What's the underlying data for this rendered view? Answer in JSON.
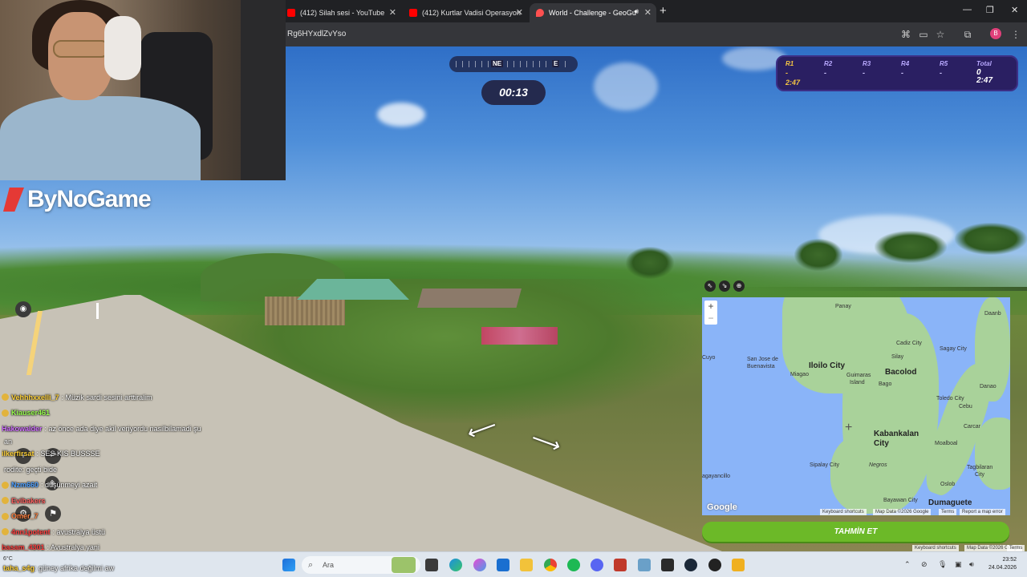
{
  "browser": {
    "tabs": [
      {
        "title": "(412) Silah sesi - YouTube",
        "color": "#ff0000"
      },
      {
        "title": "(412) Kurtlar Vadisi Operasyon",
        "color": "#ff0000"
      },
      {
        "title": "World - Challenge - GeoGu",
        "color": "#ff5050"
      }
    ],
    "url": "Rg6HYxdlZvYso"
  },
  "stream": {
    "logo_text": "ByNoGame"
  },
  "game": {
    "compass": {
      "ne": "NE",
      "e": "E"
    },
    "timer": "00:13",
    "rounds": [
      {
        "label": "R1",
        "value": "2:47"
      },
      {
        "label": "R2",
        "value": "-"
      },
      {
        "label": "R3",
        "value": "-"
      },
      {
        "label": "R4",
        "value": "-"
      },
      {
        "label": "R5",
        "value": "-"
      }
    ],
    "total": {
      "label": "Total",
      "score": "0",
      "time": "2:47"
    },
    "guess_button": "TAHMİN ET",
    "keyboard_shortcuts_bottom": "Keyboard shortcuts",
    "map_data_bottom": "Map Data ©2026 Google",
    "terms_bottom": "Terms"
  },
  "map": {
    "labels": {
      "panay": "Panay",
      "iloilo": "Iloilo City",
      "bacolod": "Bacolod",
      "sanjose": "San Jose de",
      "buenavista": "Buenavista",
      "miagao": "Miagao",
      "guimaras": "Guimaras",
      "island": "Island",
      "bago": "Bago",
      "silay": "Silay",
      "cadiz": "Cadiz City",
      "sagay": "Sagay City",
      "daanb": "Daanb",
      "toledo": "Toledo City",
      "cebu": "Cebu",
      "danao": "Danao",
      "kabankalan": "Kabankalan",
      "city": "City",
      "carcar": "Carcar",
      "moalboal": "Moalboal",
      "sipalay": "Sipalay City",
      "negros": "Negros",
      "tagbilaran": "Tagbilaran",
      "city2": "City",
      "oslob": "Oslob",
      "bayawan": "Bayawan City",
      "dumaguete": "Dumaguete",
      "cuyo": "Cuyo",
      "agayancillo": "agayancillo"
    },
    "google": "Google",
    "shortcuts": "Keyboard shortcuts",
    "mapdata": "Map Data ©2026 Google",
    "terms": "Terms",
    "report": "Report a map error"
  },
  "chat": [
    {
      "user": "Vehhhxxelli_7",
      "text": ": Müzik sardi sesini arttiralim",
      "color": "#ffd23a"
    },
    {
      "user": "Kiauser461",
      "text": "",
      "color": "#9aff50"
    },
    {
      "user": "Hakowalder",
      "text": ": az önce ada diye akil veriyordu nasilbilamadi şu",
      "color": "#d070ff"
    },
    {
      "user": "",
      "text": "an",
      "color": "#ffffff"
    },
    {
      "user": "ilkerfirsat",
      "text": ": SES KIS BUSSSE",
      "color": "#ffd23a"
    },
    {
      "user": "",
      "text": "rodite: geçti bide",
      "color": "#ffffff"
    },
    {
      "user": "Nzm660",
      "text": ": düşünmeyi azait",
      "color": "#4fa0ff"
    },
    {
      "user": "Evibakers",
      "text": "",
      "color": "#ff6060"
    },
    {
      "user": "Omer_7",
      "text": "",
      "color": "#ff8040"
    },
    {
      "user": "4nn1potent",
      "text": ": avustralya üstü",
      "color": "#ff4040"
    },
    {
      "user": "basam_4301",
      "text": ": Avustralya yani",
      "color": "#ff4040"
    },
    {
      "user": "taha_s4g",
      "text": ": güney afrika değilmi aw",
      "color": "#ffd23a"
    }
  ],
  "taskbar": {
    "weather_temp": "6°C",
    "search_label": "Ara",
    "time": "23:52",
    "date": "24.04.2026"
  }
}
